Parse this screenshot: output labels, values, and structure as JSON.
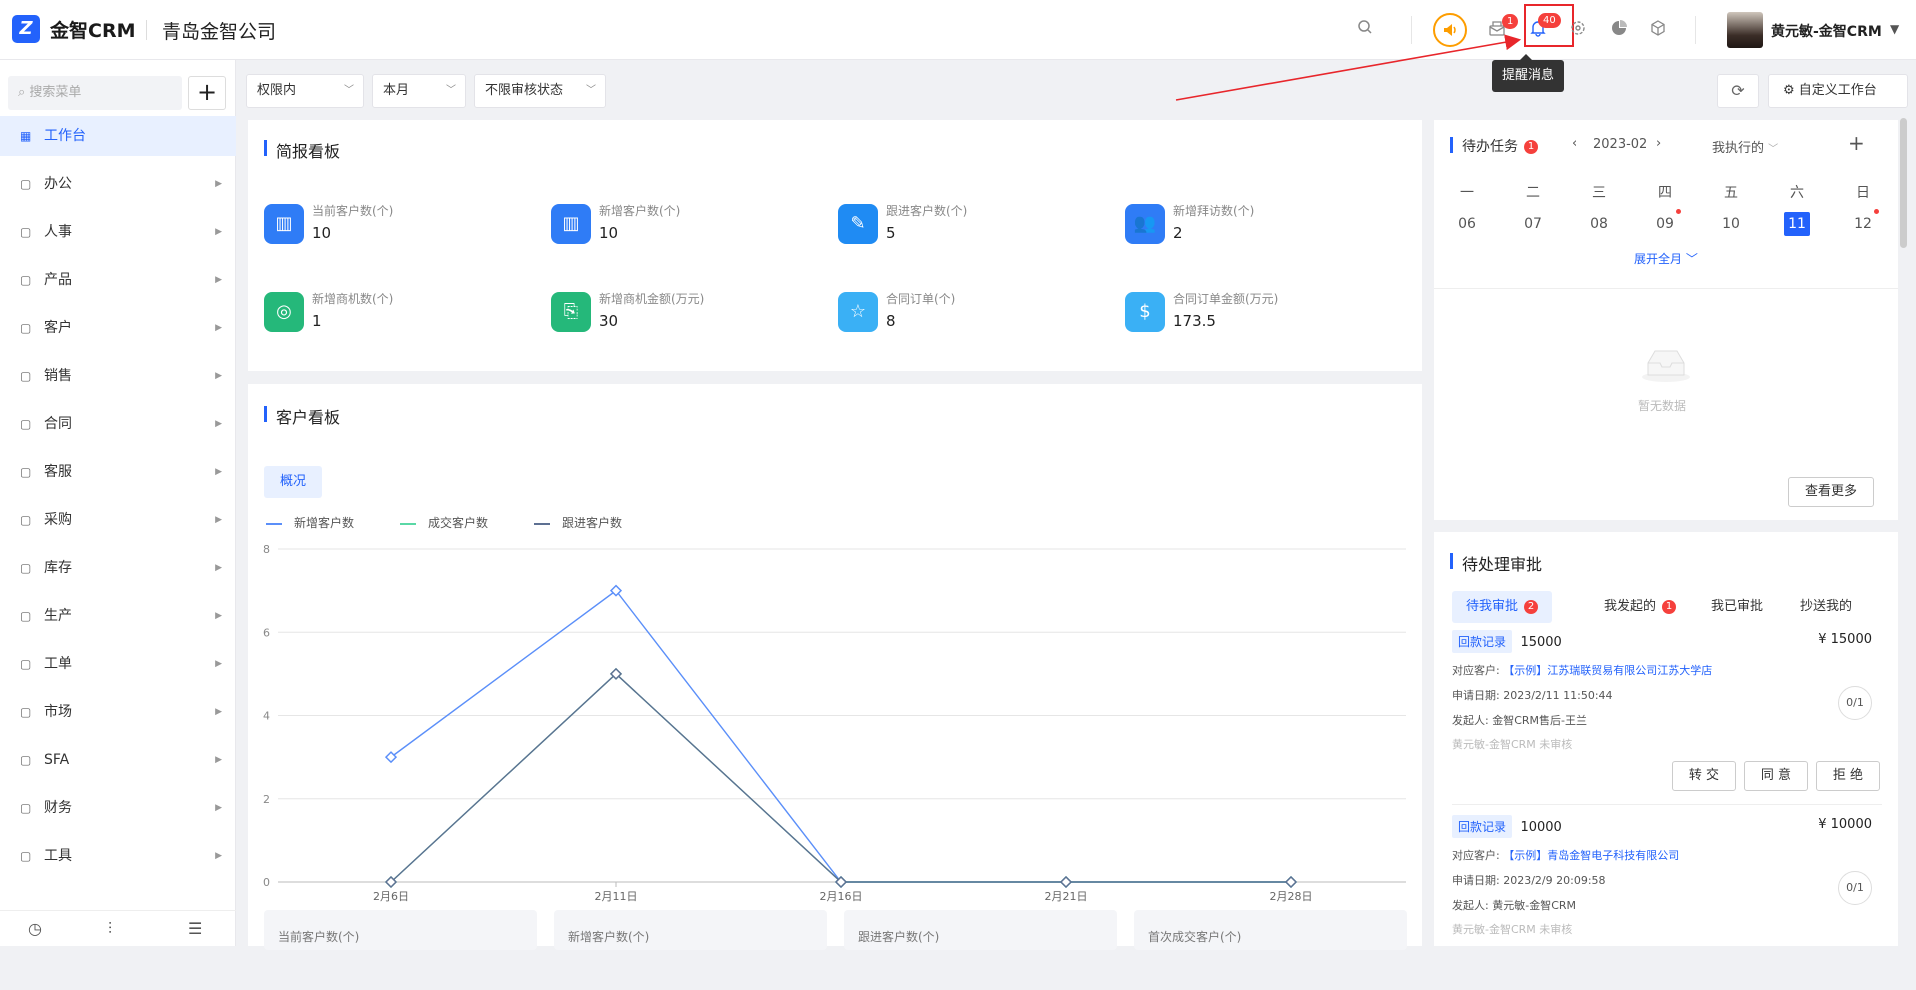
{
  "app": {
    "logo_letter": "Z",
    "name": "金智CRM",
    "company": "青岛金智公司"
  },
  "header": {
    "mail_badge": "1",
    "bell_badge": "40",
    "tooltip": "提醒消息",
    "user_name": "黄元敏-金智CRM",
    "accent": "#2362fb",
    "alert_color": "#e8262b"
  },
  "sidebar": {
    "search_placeholder": "搜索菜单",
    "add_label": "+",
    "items": [
      {
        "label": "工作台",
        "icon": "dashboard-icon"
      },
      {
        "label": "办公",
        "icon": "office-icon"
      },
      {
        "label": "人事",
        "icon": "people-icon"
      },
      {
        "label": "产品",
        "icon": "cube-icon"
      },
      {
        "label": "客户",
        "icon": "building-icon"
      },
      {
        "label": "销售",
        "icon": "sales-icon"
      },
      {
        "label": "合同",
        "icon": "document-icon"
      },
      {
        "label": "客服",
        "icon": "headset-icon"
      },
      {
        "label": "采购",
        "icon": "bag-icon"
      },
      {
        "label": "库存",
        "icon": "warehouse-icon"
      },
      {
        "label": "生产",
        "icon": "flow-icon"
      },
      {
        "label": "工单",
        "icon": "ticket-icon"
      },
      {
        "label": "市场",
        "icon": "market-icon"
      },
      {
        "label": "SFA",
        "icon": "sfa-icon"
      },
      {
        "label": "财务",
        "icon": "finance-icon"
      },
      {
        "label": "工具",
        "icon": "tool-icon"
      }
    ]
  },
  "filters": {
    "scope": "权限内",
    "period": "本月",
    "audit": "不限审核状态",
    "custom_label": "自定义工作台"
  },
  "briefing": {
    "title": "简报看板",
    "stats": [
      {
        "label": "当前客户数(个)",
        "value": "10",
        "color": "#2f7cf6"
      },
      {
        "label": "新增客户数(个)",
        "value": "10",
        "color": "#2f7cf6"
      },
      {
        "label": "跟进客户数(个)",
        "value": "5",
        "color": "#1f8bf3"
      },
      {
        "label": "新增拜访数(个)",
        "value": "2",
        "color": "#2f7cf6"
      },
      {
        "label": "新增商机数(个)",
        "value": "1",
        "color": "#25b87a"
      },
      {
        "label": "新增商机金额(万元)",
        "value": "30",
        "color": "#25b87a"
      },
      {
        "label": "合同订单(个)",
        "value": "8",
        "color": "#3ab0f5"
      },
      {
        "label": "合同订单金额(万元)",
        "value": "173.5",
        "color": "#3ab0f5"
      }
    ]
  },
  "customer_board": {
    "title": "客户看板",
    "tab": "概况",
    "bottom_cards": [
      "当前客户数(个)",
      "新增客户数(个)",
      "跟进客户数(个)",
      "首次成交客户(个)"
    ]
  },
  "chart_data": {
    "type": "line",
    "x": [
      "2月6日",
      "2月11日",
      "2月16日",
      "2月21日",
      "2月28日"
    ],
    "series": [
      {
        "name": "新增客户数",
        "values": [
          3,
          7,
          0,
          0,
          0
        ],
        "color": "#5b8ff9"
      },
      {
        "name": "成交客户数",
        "values": [
          0,
          5,
          0,
          0,
          0
        ],
        "color": "#5ad8a6"
      },
      {
        "name": "跟进客户数",
        "values": [
          0,
          5,
          0,
          0,
          0
        ],
        "color": "#5d7092"
      }
    ],
    "ylim": [
      0,
      8
    ],
    "yticks": [
      0,
      2,
      4,
      6,
      8
    ],
    "grid": true,
    "legend": "top-left"
  },
  "todo": {
    "title": "待办任务",
    "badge": "1",
    "month": "2023-02",
    "filter": "我执行的",
    "weekdays": [
      "一",
      "二",
      "三",
      "四",
      "五",
      "六",
      "日"
    ],
    "days": [
      "06",
      "07",
      "08",
      "09",
      "10",
      "11",
      "12"
    ],
    "expand": "展开全月",
    "empty": "暂无数据",
    "more": "查看更多"
  },
  "approval": {
    "title": "待处理审批",
    "tabs": [
      {
        "label": "待我审批",
        "badge": "2"
      },
      {
        "label": "我发起的",
        "badge": "1"
      },
      {
        "label": "我已审批",
        "badge": ""
      },
      {
        "label": "抄送我的",
        "badge": ""
      }
    ],
    "items": [
      {
        "tag": "回款记录",
        "amount": "15000",
        "amount_right": "¥ 15000",
        "customer_label": "对应客户:",
        "customer": "【示例】江苏瑞联贸易有限公司江苏大学店",
        "date_label": "申请日期:",
        "date": "2023/2/11 11:50:44",
        "initiator_label": "发起人:",
        "initiator": "金智CRM售后-王兰",
        "status": "黄元敏-金智CRM 未审核",
        "progress": "0/1"
      },
      {
        "tag": "回款记录",
        "amount": "10000",
        "amount_right": "¥ 10000",
        "customer_label": "对应客户:",
        "customer": "【示例】青岛金智电子科技有限公司",
        "date_label": "申请日期:",
        "date": "2023/2/9 20:09:58",
        "initiator_label": "发起人:",
        "initiator": "黄元敏-金智CRM",
        "status": "黄元敏-金智CRM 未审核",
        "progress": "0/1"
      }
    ],
    "actions": [
      "转 交",
      "同 意",
      "拒 绝"
    ]
  }
}
